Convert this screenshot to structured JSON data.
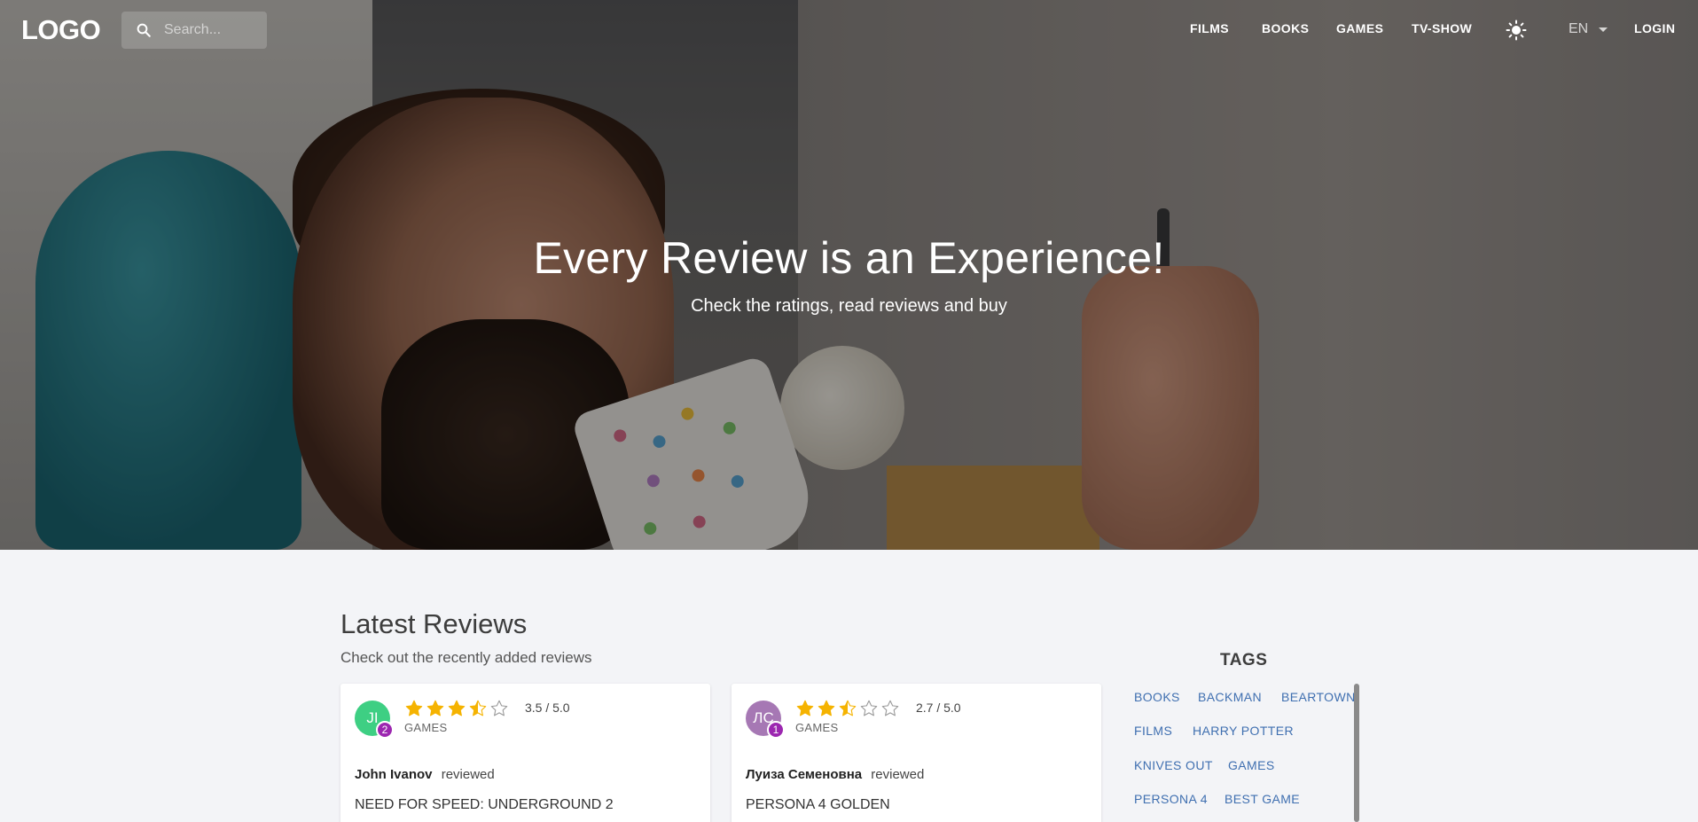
{
  "brand": {
    "logo": "LOGO"
  },
  "search": {
    "placeholder": "Search..."
  },
  "nav": {
    "items": [
      {
        "label": "FILMS"
      },
      {
        "label": "BOOKS"
      },
      {
        "label": "GAMES"
      },
      {
        "label": "TV-SHOW"
      }
    ],
    "theme_icon": "sun-icon",
    "language": "EN",
    "login": "LOGIN"
  },
  "hero": {
    "title": "Every Review is an Experience!",
    "subtitle": "Check the ratings, read reviews and buy"
  },
  "latest": {
    "title": "Latest Reviews",
    "subtitle": "Check out the recently added reviews",
    "reviews": [
      {
        "initials": "JI",
        "avatar_color": "#3ecf83",
        "badge": "2",
        "rating": 3.5,
        "rating_text": "3.5 / 5.0",
        "category": "GAMES",
        "author": "John Ivanov",
        "action": "reviewed",
        "item": "NEED FOR SPEED: UNDERGROUND 2"
      },
      {
        "initials": "ЛС",
        "avatar_color": "#a678b4",
        "badge": "1",
        "rating": 2.7,
        "rating_text": "2.7 / 5.0",
        "category": "GAMES",
        "author": "Луиза Семеновна",
        "action": "reviewed",
        "item": "PERSONA 4 GOLDEN"
      }
    ]
  },
  "tags": {
    "title": "TAGS",
    "items": [
      "BOOKS",
      "BACKMAN",
      "BEARTOWN",
      "FILMS",
      "HARRY POTTER",
      "KNIVES OUT",
      "GAMES",
      "PERSONA 4",
      "BEST GAME"
    ]
  },
  "colors": {
    "star": "#f5b301",
    "tag": "#3f6fb0",
    "badge": "#9c27b0",
    "page_bg": "#f3f4f7"
  }
}
